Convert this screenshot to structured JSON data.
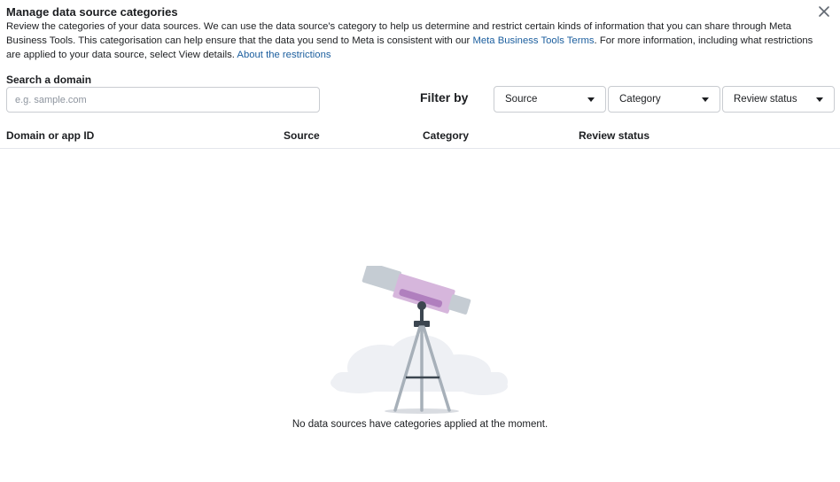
{
  "dialog": {
    "title": "Manage data source categories",
    "description_text": "Review the categories of your data sources. We can use the data source's category to help us determine and restrict certain kinds of information that you can share through Meta Business Tools. This categorisation can help ensure that the data you send to Meta is consistent with our ",
    "terms_link": "Meta Business Tools Terms",
    "description_text_2": ". For more information, including what restrictions are applied to your data source, select View details. ",
    "restrictions_link": "About the restrictions"
  },
  "search": {
    "label": "Search a domain",
    "placeholder": "e.g. sample.com",
    "value": ""
  },
  "filters": {
    "label": "Filter by",
    "source": "Source",
    "category": "Category",
    "review_status": "Review status"
  },
  "table": {
    "columns": [
      "Domain or app ID",
      "Source",
      "Category",
      "Review status"
    ]
  },
  "empty_state": {
    "message": "No data sources have categories applied at the moment.",
    "icon": "telescope-illustration"
  },
  "icons": {
    "close": "close-icon"
  }
}
